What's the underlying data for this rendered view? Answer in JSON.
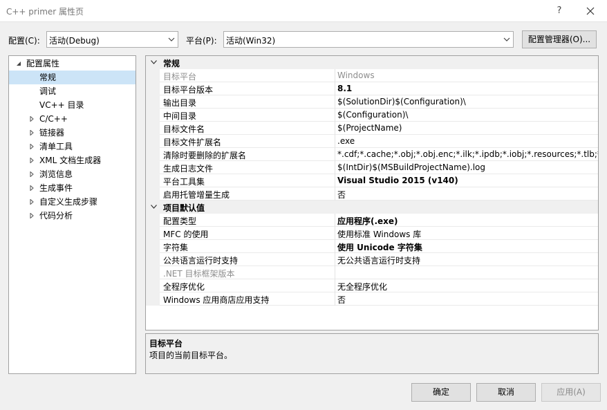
{
  "window": {
    "title": "C++ primer 属性页",
    "help_label": "?"
  },
  "toolbar": {
    "config_label": "配置(C):",
    "config_value": "活动(Debug)",
    "platform_label": "平台(P):",
    "platform_value": "活动(Win32)",
    "config_manager_label": "配置管理器(O)..."
  },
  "tree": {
    "root_label": "配置属性",
    "items": [
      {
        "label": "常规",
        "expandable": false,
        "selected": true
      },
      {
        "label": "调试",
        "expandable": false,
        "selected": false
      },
      {
        "label": "VC++ 目录",
        "expandable": false,
        "selected": false
      },
      {
        "label": "C/C++",
        "expandable": true,
        "selected": false
      },
      {
        "label": "链接器",
        "expandable": true,
        "selected": false
      },
      {
        "label": "清单工具",
        "expandable": true,
        "selected": false
      },
      {
        "label": "XML 文档生成器",
        "expandable": true,
        "selected": false
      },
      {
        "label": "浏览信息",
        "expandable": true,
        "selected": false
      },
      {
        "label": "生成事件",
        "expandable": true,
        "selected": false
      },
      {
        "label": "自定义生成步骤",
        "expandable": true,
        "selected": false
      },
      {
        "label": "代码分析",
        "expandable": true,
        "selected": false
      }
    ]
  },
  "grid": {
    "categories": [
      {
        "title": "常规",
        "rows": [
          {
            "name": "目标平台",
            "value": "Windows",
            "bold": false,
            "gray": true
          },
          {
            "name": "目标平台版本",
            "value": "8.1",
            "bold": true,
            "gray": false
          },
          {
            "name": "输出目录",
            "value": "$(SolutionDir)$(Configuration)\\",
            "bold": false,
            "gray": false
          },
          {
            "name": "中间目录",
            "value": "$(Configuration)\\",
            "bold": false,
            "gray": false
          },
          {
            "name": "目标文件名",
            "value": "$(ProjectName)",
            "bold": false,
            "gray": false
          },
          {
            "name": "目标文件扩展名",
            "value": ".exe",
            "bold": false,
            "gray": false
          },
          {
            "name": "清除时要删除的扩展名",
            "value": "*.cdf;*.cache;*.obj;*.obj.enc;*.ilk;*.ipdb;*.iobj;*.resources;*.tlb;*.tli;*.t",
            "bold": false,
            "gray": false
          },
          {
            "name": "生成日志文件",
            "value": "$(IntDir)$(MSBuildProjectName).log",
            "bold": false,
            "gray": false
          },
          {
            "name": "平台工具集",
            "value": "Visual Studio 2015 (v140)",
            "bold": true,
            "gray": false
          },
          {
            "name": "启用托管增量生成",
            "value": "否",
            "bold": false,
            "gray": false
          }
        ]
      },
      {
        "title": "项目默认值",
        "rows": [
          {
            "name": "配置类型",
            "value": "应用程序(.exe)",
            "bold": true,
            "gray": false
          },
          {
            "name": "MFC 的使用",
            "value": "使用标准 Windows 库",
            "bold": false,
            "gray": false
          },
          {
            "name": "字符集",
            "value": "使用 Unicode 字符集",
            "bold": true,
            "gray": false
          },
          {
            "name": "公共语言运行时支持",
            "value": "无公共语言运行时支持",
            "bold": false,
            "gray": false
          },
          {
            "name": ".NET 目标框架版本",
            "value": "",
            "bold": false,
            "gray": true
          },
          {
            "name": "全程序优化",
            "value": "无全程序优化",
            "bold": false,
            "gray": false
          },
          {
            "name": "Windows 应用商店应用支持",
            "value": "否",
            "bold": false,
            "gray": false
          }
        ]
      }
    ]
  },
  "description": {
    "title": "目标平台",
    "text": "项目的当前目标平台。"
  },
  "buttons": {
    "ok": "确定",
    "cancel": "取消",
    "apply": "应用(A)"
  },
  "colors": {
    "selection": "#cce4f7",
    "panel_bg": "#f0f0f0",
    "border": "#a0a0a0"
  }
}
